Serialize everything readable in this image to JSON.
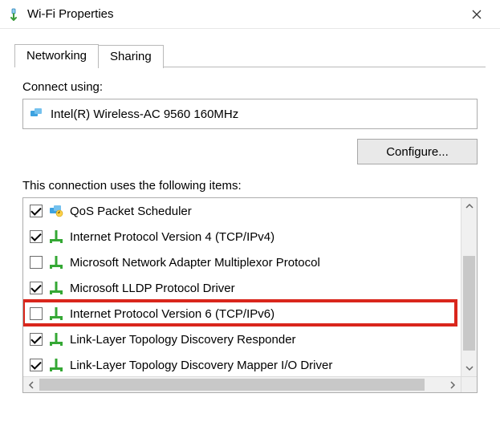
{
  "titlebar": {
    "title": "Wi-Fi Properties"
  },
  "tabs": [
    {
      "label": "Networking",
      "active": true
    },
    {
      "label": "Sharing",
      "active": false
    }
  ],
  "connect_label": "Connect using:",
  "adapter": {
    "name": "Intel(R) Wireless-AC 9560 160MHz"
  },
  "configure_label": "Configure...",
  "items_label": "This connection uses the following items:",
  "items": [
    {
      "label": "QoS Packet Scheduler",
      "checked": true,
      "icon": "qos",
      "highlighted": false
    },
    {
      "label": "Internet Protocol Version 4 (TCP/IPv4)",
      "checked": true,
      "icon": "net",
      "highlighted": false
    },
    {
      "label": "Microsoft Network Adapter Multiplexor Protocol",
      "checked": false,
      "icon": "net",
      "highlighted": false
    },
    {
      "label": "Microsoft LLDP Protocol Driver",
      "checked": true,
      "icon": "net",
      "highlighted": false
    },
    {
      "label": "Internet Protocol Version 6 (TCP/IPv6)",
      "checked": false,
      "icon": "net",
      "highlighted": true
    },
    {
      "label": "Link-Layer Topology Discovery Responder",
      "checked": true,
      "icon": "net",
      "highlighted": false
    },
    {
      "label": "Link-Layer Topology Discovery Mapper I/O Driver",
      "checked": true,
      "icon": "net",
      "highlighted": false
    }
  ]
}
